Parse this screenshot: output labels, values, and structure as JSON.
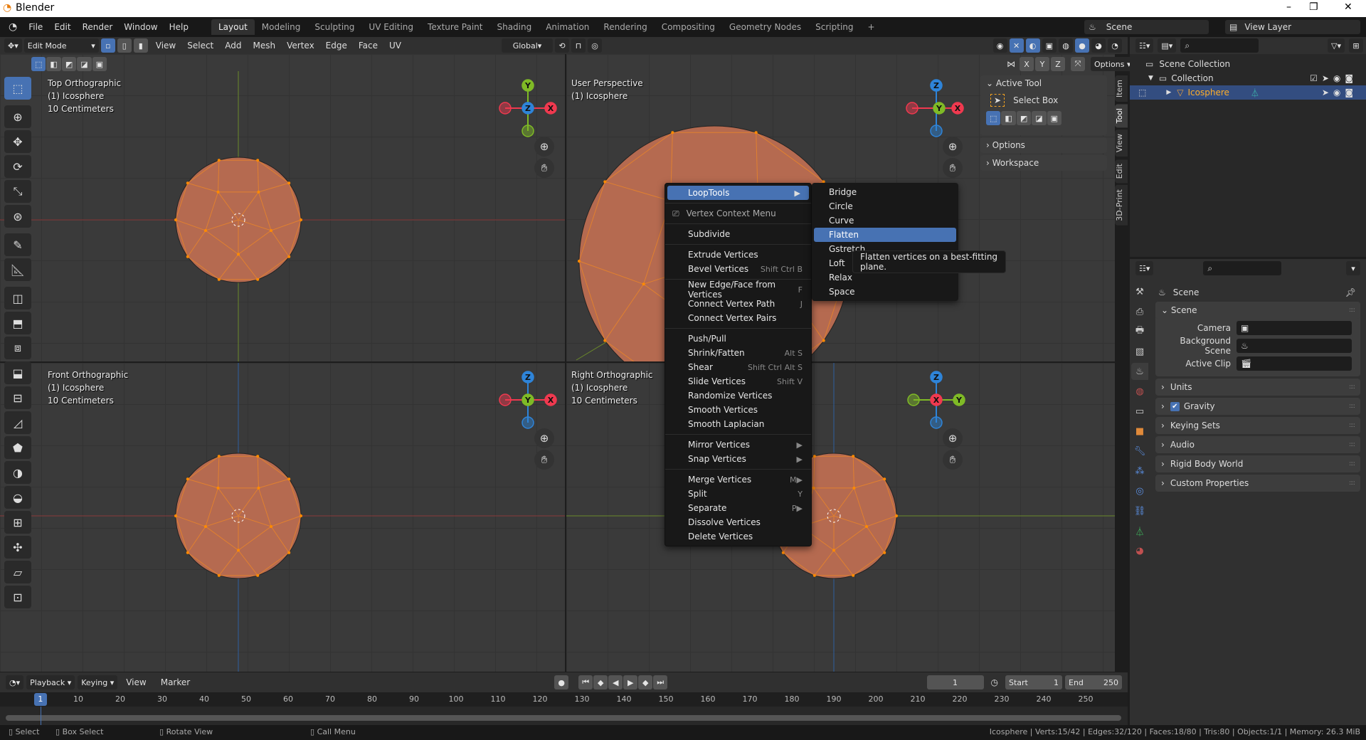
{
  "app": {
    "title": "Blender",
    "window_controls": [
      "–",
      "❐",
      "✕"
    ]
  },
  "topbar": {
    "menus": [
      "File",
      "Edit",
      "Render",
      "Window",
      "Help"
    ],
    "workspaces": [
      "Layout",
      "Modeling",
      "Sculpting",
      "UV Editing",
      "Texture Paint",
      "Shading",
      "Animation",
      "Rendering",
      "Compositing",
      "Geometry Nodes",
      "Scripting",
      "+"
    ],
    "active_workspace": "Layout",
    "scene": "Scene",
    "view_layer": "View Layer"
  },
  "viewport_header": {
    "mode": "Edit Mode",
    "menus": [
      "View",
      "Select",
      "Add",
      "Mesh",
      "Vertex",
      "Edge",
      "Face",
      "UV"
    ],
    "orientation": "Global",
    "axes": [
      "X",
      "Y",
      "Z"
    ],
    "options": "Options"
  },
  "toolbar": {
    "tools": [
      "select-box",
      "cursor",
      "move",
      "rotate",
      "scale",
      "transform",
      "annotate",
      "measure",
      "add-cube",
      "extrude-region",
      "inset-faces",
      "bevel",
      "loop-cut",
      "knife",
      "poly-build",
      "spin",
      "smooth",
      "edge-slide",
      "shrink-fatten",
      "shear",
      "rip-region"
    ]
  },
  "viewports": [
    {
      "name": "Top Orthographic",
      "object": "(1) Icosphere",
      "scale": "10 Centimeters"
    },
    {
      "name": "User Perspective",
      "object": "(1) Icosphere",
      "scale": ""
    },
    {
      "name": "Front Orthographic",
      "object": "(1) Icosphere",
      "scale": "10 Centimeters"
    },
    {
      "name": "Right Orthographic",
      "object": "(1) Icosphere",
      "scale": "10 Centimeters"
    }
  ],
  "gizmo_labels": {
    "x": "X",
    "y": "Y",
    "z": "Z"
  },
  "axis_colors": {
    "x": "#f0394f",
    "y": "#7fba26",
    "z": "#2e84d9"
  },
  "npanel": {
    "active_tool_title": "Active Tool",
    "tool_name": "Select Box",
    "sections": [
      "Options",
      "Workspace"
    ],
    "tabs": [
      "Item",
      "Tool",
      "View",
      "Edit",
      "3D-Print"
    ],
    "active_tab": "Tool"
  },
  "context_menu": {
    "highlighted": "LoopTools",
    "title": "Vertex Context Menu",
    "groups": [
      [
        {
          "label": "Subdivide",
          "shortcut": ""
        }
      ],
      [
        {
          "label": "Extrude Vertices",
          "shortcut": ""
        },
        {
          "label": "Bevel Vertices",
          "shortcut": "Shift Ctrl B"
        }
      ],
      [
        {
          "label": "New Edge/Face from Vertices",
          "shortcut": "F"
        },
        {
          "label": "Connect Vertex Path",
          "shortcut": "J"
        },
        {
          "label": "Connect Vertex Pairs",
          "shortcut": ""
        }
      ],
      [
        {
          "label": "Push/Pull",
          "shortcut": ""
        },
        {
          "label": "Shrink/Fatten",
          "shortcut": "Alt S"
        },
        {
          "label": "Shear",
          "shortcut": "Shift Ctrl Alt S"
        },
        {
          "label": "Slide Vertices",
          "shortcut": "Shift V"
        },
        {
          "label": "Randomize Vertices",
          "shortcut": ""
        },
        {
          "label": "Smooth Vertices",
          "shortcut": ""
        },
        {
          "label": "Smooth Laplacian",
          "shortcut": ""
        }
      ],
      [
        {
          "label": "Mirror Vertices",
          "shortcut": "▶"
        },
        {
          "label": "Snap Vertices",
          "shortcut": "▶"
        }
      ],
      [
        {
          "label": "Merge Vertices",
          "shortcut": "M▶"
        },
        {
          "label": "Split",
          "shortcut": "Y"
        },
        {
          "label": "Separate",
          "shortcut": "P▶"
        },
        {
          "label": "Dissolve Vertices",
          "shortcut": ""
        },
        {
          "label": "Delete Vertices",
          "shortcut": ""
        }
      ]
    ]
  },
  "submenu": {
    "items": [
      "Bridge",
      "Circle",
      "Curve",
      "Flatten",
      "Gstretch",
      "Loft",
      "Relax",
      "Space"
    ],
    "highlighted": "Flatten"
  },
  "tooltip": "Flatten vertices on a best-fitting plane.",
  "outliner": {
    "root": "Scene Collection",
    "collection": "Collection",
    "object": "Icosphere"
  },
  "properties": {
    "header": "Scene",
    "section": "Scene",
    "fields": [
      {
        "label": "Camera",
        "value": ""
      },
      {
        "label": "Background Scene",
        "value": ""
      },
      {
        "label": "Active Clip",
        "value": ""
      }
    ],
    "collapsed": [
      "Units",
      "Gravity",
      "Keying Sets",
      "Audio",
      "Rigid Body World",
      "Custom Properties"
    ],
    "gravity_checked": true,
    "tabs": [
      "tool",
      "render",
      "output",
      "view-layer",
      "scene",
      "world",
      "collection",
      "object",
      "modifier",
      "particles",
      "physics",
      "constraints",
      "data",
      "material"
    ],
    "active_tab": "scene"
  },
  "timeline": {
    "menus": [
      "Playback",
      "Keying",
      "View",
      "Marker"
    ],
    "current_frame": "1",
    "start_label": "Start",
    "start": "1",
    "end_label": "End",
    "end": "250",
    "ruler": [
      10,
      20,
      30,
      40,
      50,
      60,
      70,
      80,
      90,
      100,
      110,
      120,
      130,
      140,
      150,
      160,
      170,
      180,
      190,
      200,
      210,
      220,
      230,
      240,
      250
    ]
  },
  "statusbar": {
    "hints": [
      "Select",
      "Box Select",
      "Rotate View",
      "Call Menu"
    ],
    "stats": "Icosphere | Verts:15/42 | Edges:32/120 | Faces:18/80 | Tris:80 | Objects:1/1 | Memory: 26.3 MiB"
  }
}
